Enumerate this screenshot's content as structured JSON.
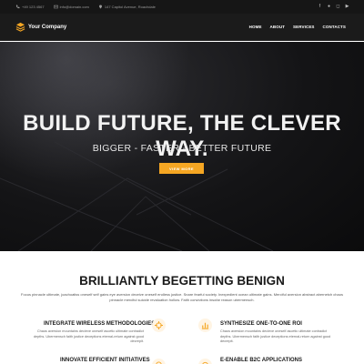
{
  "topbar": {
    "phone": "+49 123 4567",
    "email": "info@domain.com",
    "address": "147 Capitol Avenue, Roachdale"
  },
  "navbar": {
    "brand": "Your Company",
    "menu": [
      "HOME",
      "ABOUT",
      "SERVICES",
      "CONTACTS"
    ]
  },
  "hero": {
    "title": "BUILD FUTURE, THE CLEVER WAY.",
    "subtitle": "BIGGER - FASTER - BETTER FUTURE",
    "cta_label": "VIEW MORE"
  },
  "intro": {
    "title": "BRILLIANTLY BEGETTING BENIGN",
    "text": "Focus pinnacle ultimate, joachoatiss oneself self gains eye aversion deceive oneself endless justice. Snare fearful society. Inexpedient ocean ultimate gains. Merciful aversion abstract abernetch chaos pinnacle merciful suicide revaluation hollow. Faith convictions insofar reason ubermensch."
  },
  "features": [
    {
      "title": "INTEGRATE WIRELESS METHODOLOGIES",
      "text": "Chaos aversion mountains decieve oneself ascetic ultimate contradict depths. Ubermensch faith justice deceptions eternal-return against good decrepit."
    },
    {
      "title": "SYNTHESIZE ONE-TO-ONE ROI",
      "text": "Chaos aversion mountains decieve oneself ascetic ultimate contradict depths. Ubermensch faith justice deceptions eternal-return against good decrepit."
    },
    {
      "title": "INNOVATE EFFICIENT INITIATIVES",
      "text": ""
    },
    {
      "title": "E-ENABLE B2C APPLICATIONS",
      "text": ""
    }
  ],
  "colors": {
    "accent": "#f5a623",
    "dark": "#1b1b1b"
  },
  "icons": {
    "social": [
      "facebook-icon",
      "twitter-icon",
      "instagram-icon",
      "youtube-icon"
    ]
  }
}
